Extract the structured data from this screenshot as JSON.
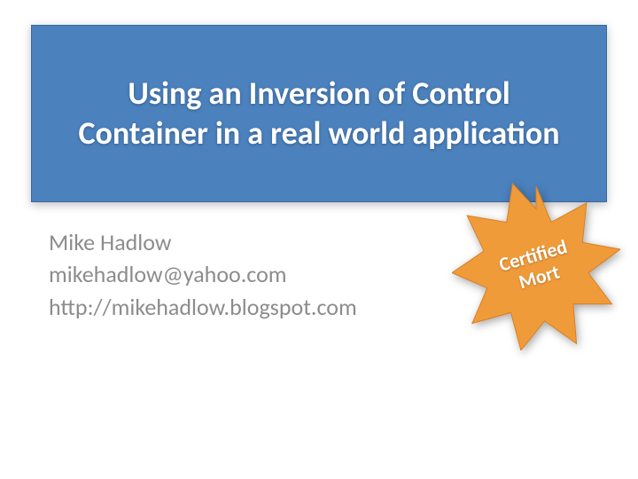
{
  "title": "Using an Inversion of Control Container in a real world application",
  "author": {
    "name": "Mike Hadlow",
    "email": "mikehadlow@yahoo.com",
    "url": "http://mikehadlow.blogspot.com"
  },
  "badge": {
    "line1": "Certified",
    "line2": "Mort"
  }
}
